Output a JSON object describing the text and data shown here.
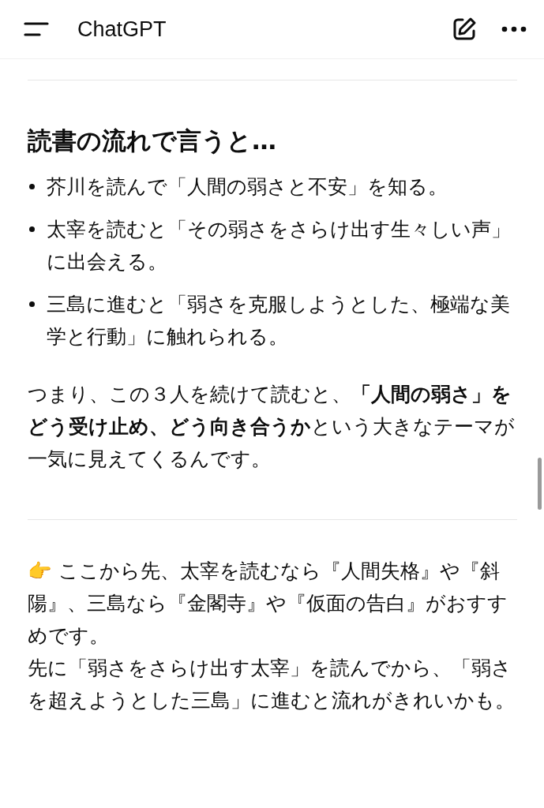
{
  "header": {
    "title": "ChatGPT"
  },
  "heading": "読書の流れで言うと…",
  "bullets": [
    "芥川を読んで「人間の弱さと不安」を知る。",
    "太宰を読むと「その弱さをさらけ出す生々しい声」に出会える。",
    "三島に進むと「弱さを克服しようとした、極端な美学と行動」に触れられる。"
  ],
  "summary": "つまり、この３人を続けて読むと、**「人間の弱さ」をどう受け止め、どう向き合うか**という大きなテーマが一気に見えてくるんです。",
  "closing": [
    "👉 ここから先、太宰を読むなら『人間失格』や『斜陽』、三島なら『金閣寺』や『仮面の告白』がおすすめです。",
    "先に「弱さをさらけ出す太宰」を読んでから、「弱さを超えようとした三島」に進むと流れがきれいかも。"
  ]
}
